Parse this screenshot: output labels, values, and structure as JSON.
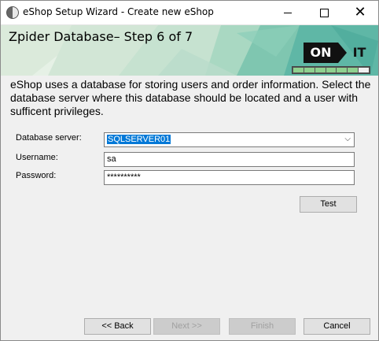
{
  "window": {
    "title": "eShop Setup Wizard - Create new eShop"
  },
  "banner": {
    "step_title": "Zpider Database– Step 6 of 7",
    "logo_left": "ON",
    "logo_right": "IT",
    "progress": {
      "completed": 6,
      "total": 7
    }
  },
  "intro_text": "eShop uses a database for storing users and order information. Select the database server where this database should be located and a user with sufficent privileges.",
  "form": {
    "server_label": "Database server:",
    "server_value": "SQLSERVER01",
    "username_label": "Username:",
    "username_value": "sa",
    "password_label": "Password:",
    "password_value": "**********"
  },
  "buttons": {
    "test": "Test",
    "back": "<< Back",
    "next": "Next >>",
    "finish": "Finish",
    "cancel": "Cancel"
  }
}
